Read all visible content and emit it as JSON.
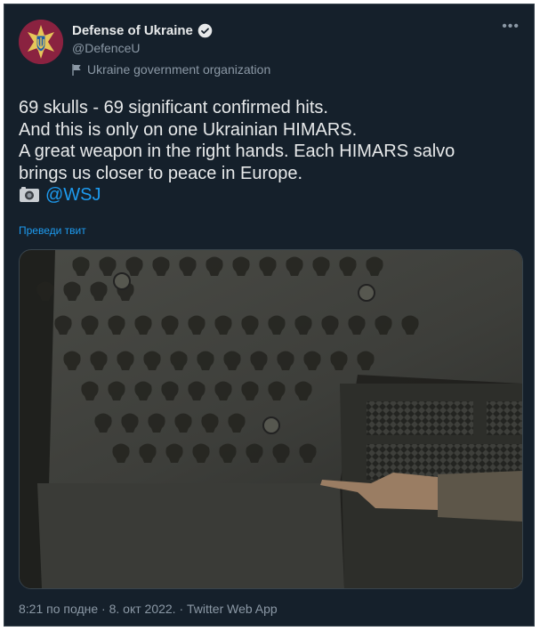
{
  "account": {
    "name": "Defense of Ukraine",
    "handle": "@DefenceU",
    "label": "Ukraine government organization"
  },
  "tweet": {
    "lines": [
      "69 skulls - 69 significant confirmed hits.",
      "And this is only on one Ukrainian HIMARS.",
      "A great weapon in the right hands. Each HIMARS salvo",
      "brings us closer to peace in Europe."
    ],
    "mention": "@WSJ",
    "translate_label": "Преведи твит"
  },
  "meta": {
    "time": "8:21 по подне",
    "sep1": " · ",
    "date": "8. окт 2022.",
    "sep2": " · ",
    "source": "Twitter Web App"
  },
  "icons": {
    "verified": "verified-badge-icon",
    "org_flag": "flag-icon",
    "camera": "camera-icon",
    "more": "more-options-icon"
  },
  "colors": {
    "background": "#15202b",
    "text": "#e7e9ea",
    "secondary": "#8b98a5",
    "accent": "#1d9bf0"
  }
}
